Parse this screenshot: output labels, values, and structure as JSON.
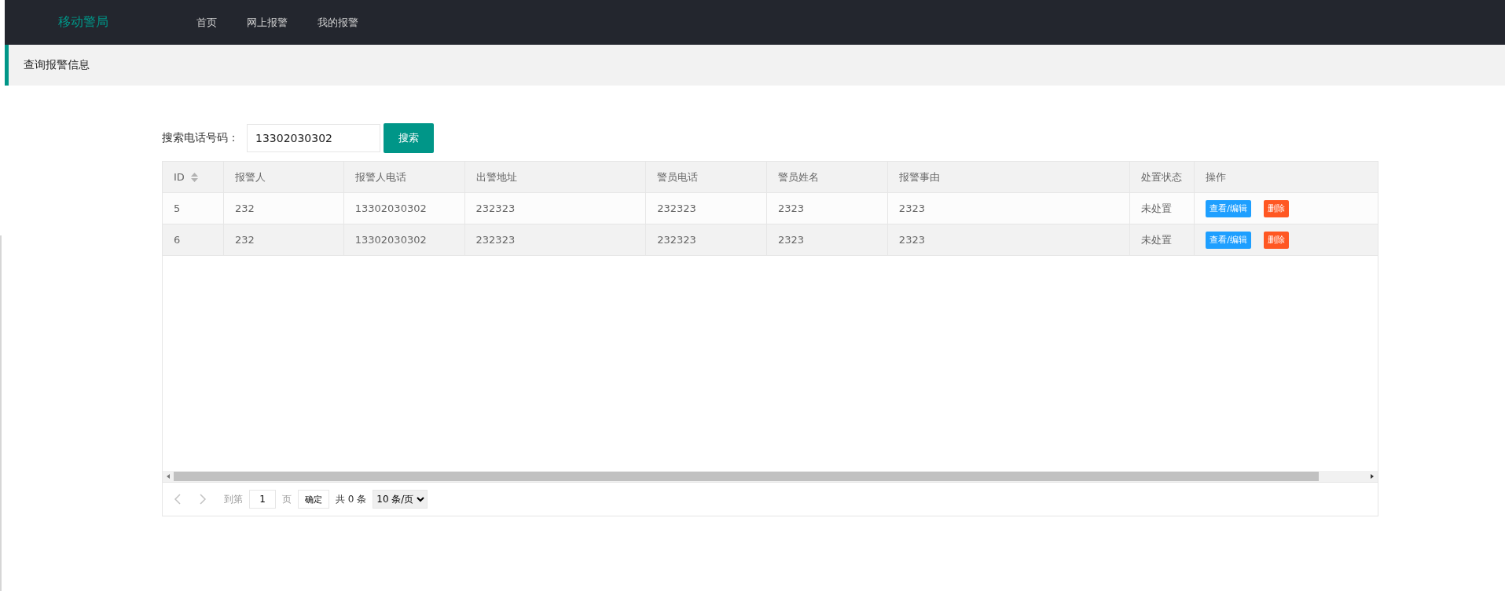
{
  "nav": {
    "brand": "移动警局",
    "items": [
      {
        "label": "首页"
      },
      {
        "label": "网上报警"
      },
      {
        "label": "我的报警"
      }
    ]
  },
  "page_title": "查询报警信息",
  "search": {
    "label": "搜索电话号码：",
    "value": "13302030302",
    "button": "搜索"
  },
  "table": {
    "columns": [
      {
        "label": "ID",
        "sortable": true
      },
      {
        "label": "报警人",
        "sortable": false
      },
      {
        "label": "报警人电话",
        "sortable": false
      },
      {
        "label": "出警地址",
        "sortable": false
      },
      {
        "label": "警员电话",
        "sortable": false
      },
      {
        "label": "警员姓名",
        "sortable": false
      },
      {
        "label": "报警事由",
        "sortable": false
      },
      {
        "label": "处置状态",
        "sortable": false
      },
      {
        "label": "操作",
        "sortable": false
      }
    ],
    "rows": [
      {
        "cells": [
          "5",
          "232",
          "13302030302",
          "232323",
          "232323",
          "2323",
          "2323",
          "未处置"
        ],
        "actions": [
          {
            "kind": "edit",
            "label": "查看/编辑"
          },
          {
            "kind": "delete",
            "label": "删除"
          }
        ]
      },
      {
        "cells": [
          "6",
          "232",
          "13302030302",
          "232323",
          "232323",
          "2323",
          "2323",
          "未处置"
        ],
        "actions": [
          {
            "kind": "edit",
            "label": "查看/编辑"
          },
          {
            "kind": "delete",
            "label": "删除"
          }
        ]
      }
    ]
  },
  "pagination": {
    "goto_label": "到第",
    "page_value": "1",
    "page_unit": "页",
    "confirm": "确定",
    "total": "共 0 条",
    "page_size": "10 条/页"
  }
}
